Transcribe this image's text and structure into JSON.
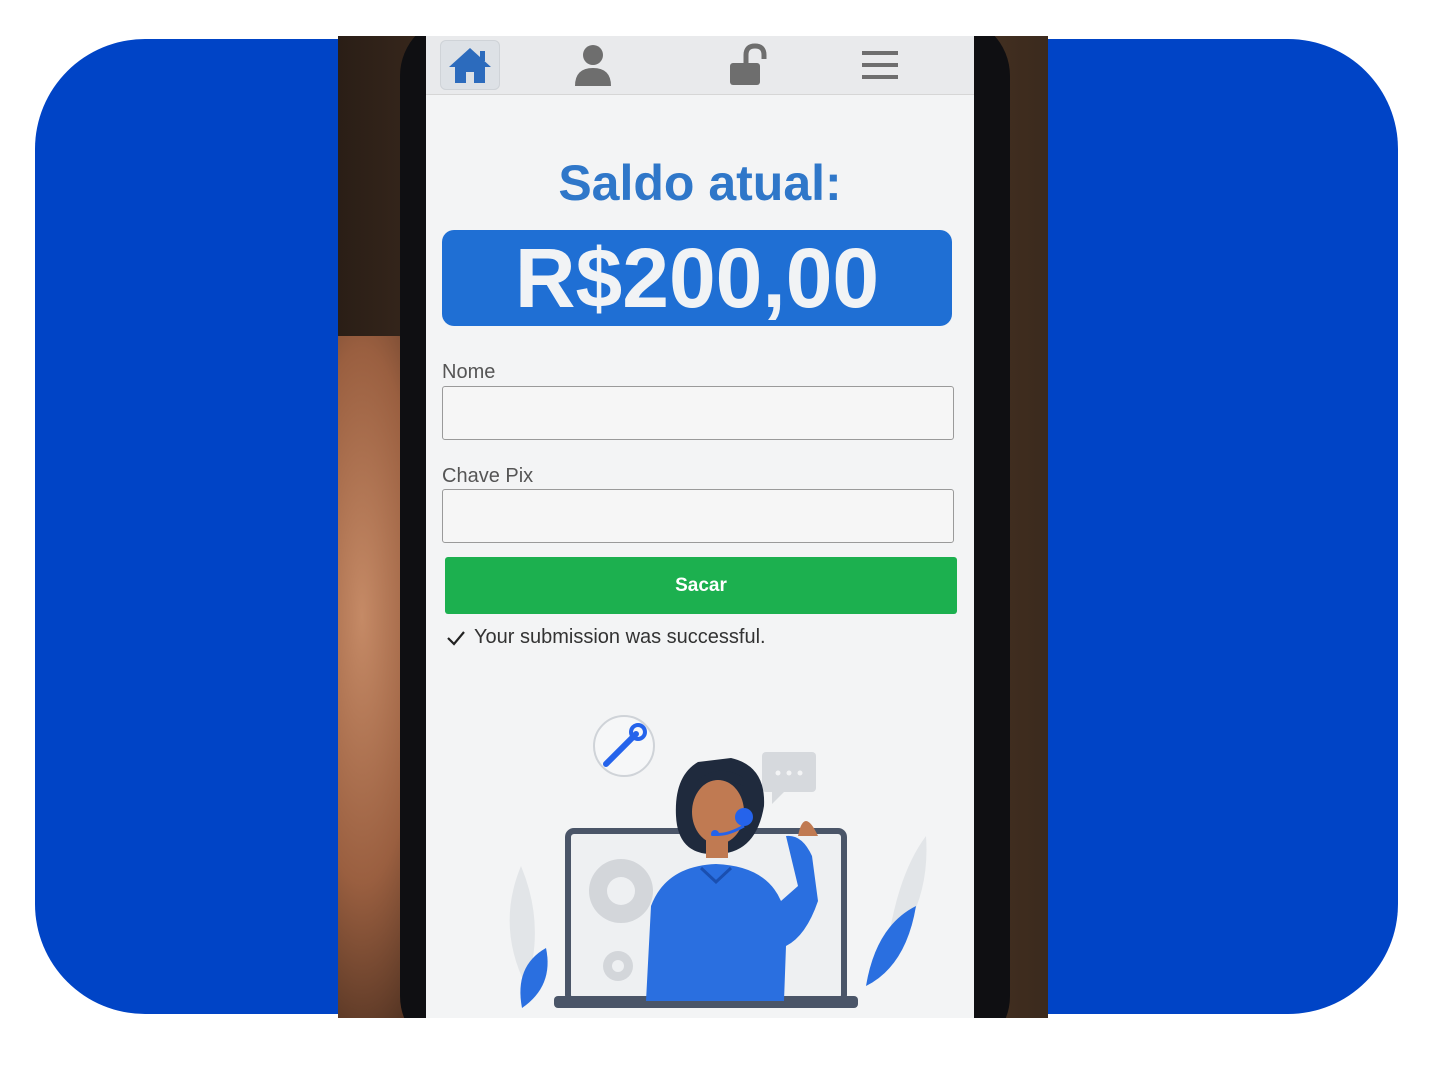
{
  "colors": {
    "background_card": "#0044c6",
    "title": "#2f77c9",
    "balance_bg": "#1f6fd4",
    "button": "#1cb04f",
    "nav_icon_active": "#2c6bbd",
    "nav_icon": "#6e6e6e"
  },
  "nav": {
    "items": [
      {
        "icon": "home-icon",
        "active": true
      },
      {
        "icon": "user-icon",
        "active": false
      },
      {
        "icon": "unlock-icon",
        "active": false
      },
      {
        "icon": "menu-icon",
        "active": false
      }
    ]
  },
  "balance": {
    "title": "Saldo atual:",
    "amount": "R$200,00"
  },
  "form": {
    "name_label": "Nome",
    "name_value": "",
    "pix_label": "Chave Pix",
    "pix_value": "",
    "submit_label": "Sacar",
    "success_message": "Your submission was successful."
  },
  "illustration": {
    "icons": [
      "wrench-icon",
      "chat-bubble-icon",
      "headset-icon",
      "gear-icon"
    ]
  }
}
